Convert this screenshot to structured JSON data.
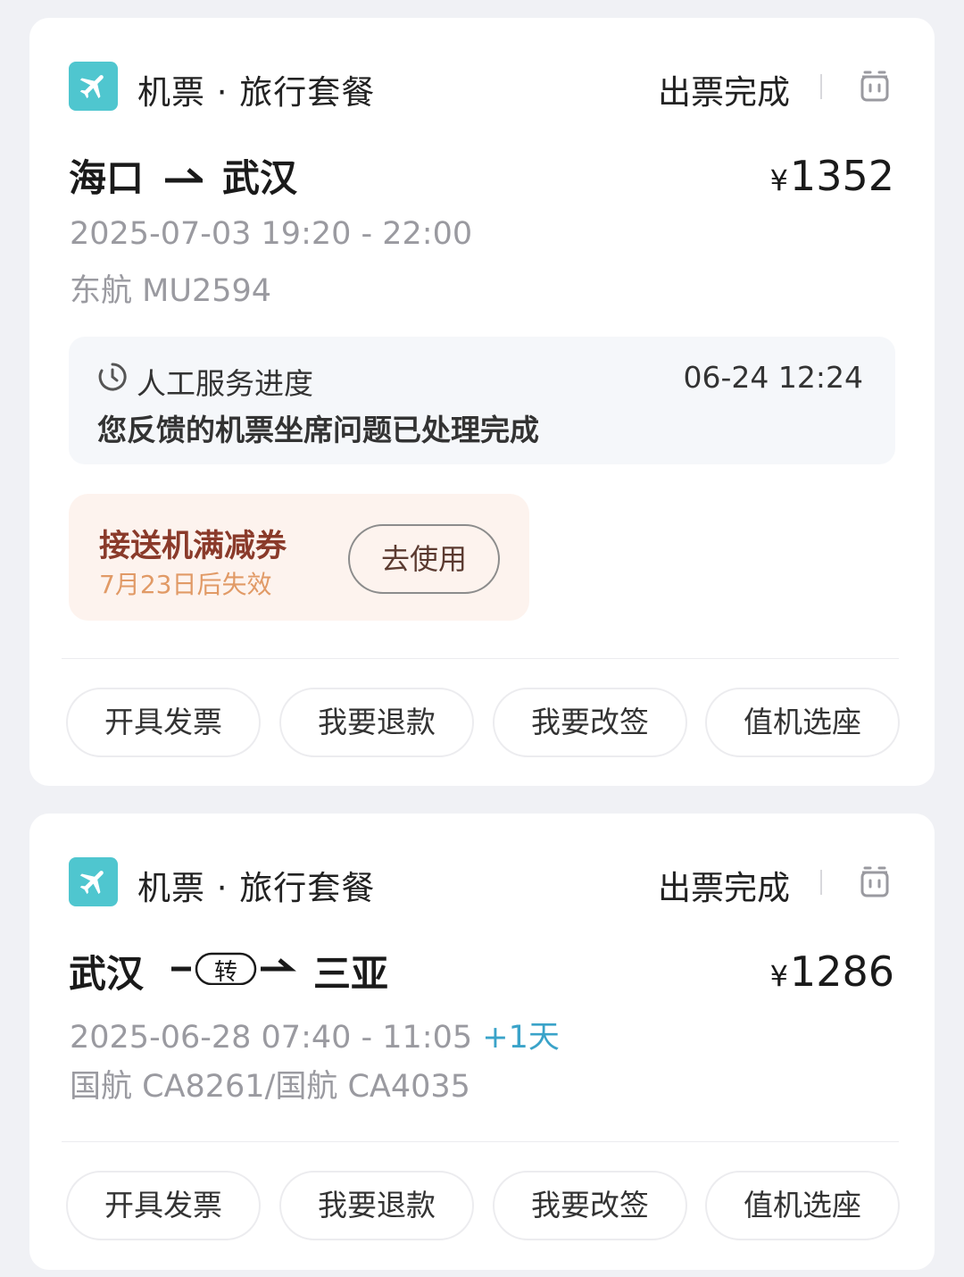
{
  "orders": [
    {
      "category": "机票 · 旅行套餐",
      "status": "出票完成",
      "route": {
        "from": "海口",
        "to": "武汉",
        "transfer": ""
      },
      "price": {
        "currency": "¥",
        "amount": "1352"
      },
      "time": "2025-07-03 19:20 - 22:00",
      "plus_day": "",
      "flight": "东航 MU2594",
      "service": {
        "title": "人工服务进度",
        "time": "06-24 12:24",
        "message": "您反馈的机票坐席问题已处理完成"
      },
      "coupon": {
        "title": "接送机满减券",
        "expire": "7月23日后失效",
        "button": "去使用"
      },
      "actions": [
        "开具发票",
        "我要退款",
        "我要改签",
        "值机选座"
      ]
    },
    {
      "category": "机票 · 旅行套餐",
      "status": "出票完成",
      "route": {
        "from": "武汉",
        "to": "三亚",
        "transfer": "转"
      },
      "price": {
        "currency": "¥",
        "amount": "1286"
      },
      "time": "2025-06-28 07:40 - 11:05",
      "plus_day": "+1天",
      "flight": "国航 CA8261/国航 CA4035",
      "actions": [
        "开具发票",
        "我要退款",
        "我要改签",
        "值机选座"
      ]
    }
  ],
  "colors": {
    "background": "#f0f1f5",
    "app_icon": "#4fc6cf",
    "plus_day": "#3aa3c9",
    "coupon_bg": "#fdf3ee",
    "coupon_title": "#8a3a2a",
    "coupon_expire": "#e19a66"
  },
  "icons": {
    "app": "airplane-icon",
    "delete": "trash-icon",
    "route_arrow": "arrow-right-icon",
    "service": "clock-icon"
  }
}
